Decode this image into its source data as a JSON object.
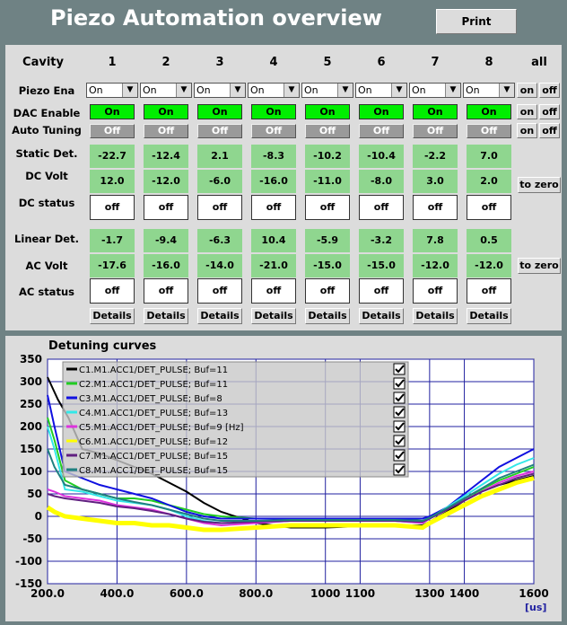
{
  "title": "Piezo Automation overview",
  "print_label": "Print",
  "cavity_header": "Cavity",
  "all_label": "all",
  "cavities": [
    "1",
    "2",
    "3",
    "4",
    "5",
    "6",
    "7",
    "8"
  ],
  "rows": {
    "piezo_ena": "Piezo Ena",
    "dac_enable": "DAC Enable",
    "auto_tuning": "Auto Tuning",
    "static_det": "Static Det.",
    "dc_volt": "DC Volt",
    "dc_status": "DC status",
    "linear_det": "Linear Det.",
    "ac_volt": "AC Volt",
    "ac_status": "AC status"
  },
  "piezo_ena": [
    "On",
    "On",
    "On",
    "On",
    "On",
    "On",
    "On",
    "On"
  ],
  "dac_enable": [
    "On",
    "On",
    "On",
    "On",
    "On",
    "On",
    "On",
    "On"
  ],
  "auto_tuning": [
    "Off",
    "Off",
    "Off",
    "Off",
    "Off",
    "Off",
    "Off",
    "Off"
  ],
  "static_det": [
    "-22.7",
    "-12.4",
    "2.1",
    "-8.3",
    "-10.2",
    "-10.4",
    "-2.2",
    "7.0"
  ],
  "dc_volt": [
    "12.0",
    "-12.0",
    "-6.0",
    "-16.0",
    "-11.0",
    "-8.0",
    "3.0",
    "2.0"
  ],
  "dc_status": [
    "off",
    "off",
    "off",
    "off",
    "off",
    "off",
    "off",
    "off"
  ],
  "linear_det": [
    "-1.7",
    "-9.4",
    "-6.3",
    "10.4",
    "-5.9",
    "-3.2",
    "7.8",
    "0.5"
  ],
  "ac_volt": [
    "-17.6",
    "-16.0",
    "-14.0",
    "-21.0",
    "-15.0",
    "-15.0",
    "-12.0",
    "-12.0"
  ],
  "ac_status": [
    "off",
    "off",
    "off",
    "off",
    "off",
    "off",
    "off",
    "off"
  ],
  "details_label": "Details",
  "on_label": "on",
  "off_label": "off",
  "to_zero_label": "to zero",
  "chart_data": {
    "type": "line",
    "title": "Detuning curves",
    "xlabel": "[us]",
    "xlim": [
      200,
      1600
    ],
    "ylim": [
      -150,
      350
    ],
    "x_ticks": [
      "200.0",
      "400.0",
      "600.0",
      "800.0",
      "1000",
      "1100",
      "1300",
      "1400",
      "1600"
    ],
    "x_tick_values": [
      200,
      400,
      600,
      800,
      1000,
      1100,
      1300,
      1400,
      1600
    ],
    "y_ticks": [
      "350",
      "300",
      "250",
      "200",
      "150",
      "100",
      "50",
      "0",
      "-50",
      "-100",
      "-150"
    ],
    "legend": [
      {
        "name": "C1.M1.ACC1/DET_PULSE; Buf=11",
        "color": "#000000"
      },
      {
        "name": "C2.M1.ACC1/DET_PULSE; Buf=11",
        "color": "#22cc22"
      },
      {
        "name": "C3.M1.ACC1/DET_PULSE; Buf=8",
        "color": "#1010e0"
      },
      {
        "name": "C4.M1.ACC1/DET_PULSE; Buf=13",
        "color": "#33e8e8"
      },
      {
        "name": "C5.M1.ACC1/DET_PULSE; Buf=9 [Hz]",
        "color": "#dd33dd"
      },
      {
        "name": "C6.M1.ACC1/DET_PULSE; Buf=12",
        "color": "#ffff00"
      },
      {
        "name": "C7.M1.ACC1/DET_PULSE; Buf=15",
        "color": "#602080"
      },
      {
        "name": "C8.M1.ACC1/DET_PULSE; Buf=15",
        "color": "#208080"
      }
    ],
    "series": [
      {
        "name": "C1.M1.ACC1/DET_PULSE; Buf=11",
        "color": "#000000",
        "x": [
          200,
          230,
          260,
          300,
          350,
          400,
          450,
          500,
          550,
          600,
          650,
          700,
          800,
          900,
          1000,
          1100,
          1200,
          1280,
          1300,
          1350,
          1400,
          1450,
          1500,
          1550,
          1600
        ],
        "y": [
          310,
          260,
          220,
          150,
          140,
          125,
          110,
          95,
          75,
          55,
          30,
          10,
          -15,
          -25,
          -25,
          -22,
          -20,
          -20,
          -12,
          10,
          35,
          55,
          70,
          80,
          90
        ]
      },
      {
        "name": "C2.M1.ACC1/DET_PULSE; Buf=11",
        "color": "#22cc22",
        "x": [
          200,
          220,
          250,
          300,
          350,
          400,
          450,
          500,
          550,
          600,
          650,
          700,
          800,
          900,
          1000,
          1100,
          1200,
          1280,
          1300,
          1350,
          1400,
          1450,
          1500,
          1550,
          1600
        ],
        "y": [
          220,
          170,
          80,
          60,
          50,
          40,
          40,
          35,
          25,
          15,
          5,
          0,
          -5,
          -5,
          -5,
          -5,
          -5,
          -10,
          -5,
          15,
          40,
          60,
          80,
          95,
          110
        ]
      },
      {
        "name": "C3.M1.ACC1/DET_PULSE; Buf=8",
        "color": "#1010e0",
        "x": [
          200,
          220,
          250,
          300,
          350,
          400,
          450,
          500,
          550,
          600,
          650,
          700,
          800,
          900,
          1000,
          1100,
          1200,
          1280,
          1300,
          1350,
          1400,
          1450,
          1500,
          1550,
          1600
        ],
        "y": [
          270,
          200,
          100,
          85,
          70,
          60,
          50,
          40,
          25,
          10,
          0,
          -5,
          -5,
          -5,
          -5,
          -5,
          -5,
          -5,
          0,
          20,
          50,
          80,
          110,
          130,
          150
        ]
      },
      {
        "name": "C4.M1.ACC1/DET_PULSE; Buf=13",
        "color": "#33e8e8",
        "x": [
          200,
          220,
          250,
          300,
          350,
          400,
          450,
          500,
          550,
          600,
          650,
          700,
          800,
          900,
          1000,
          1100,
          1200,
          1280,
          1300,
          1350,
          1400,
          1450,
          1500,
          1550,
          1600
        ],
        "y": [
          200,
          150,
          60,
          55,
          45,
          35,
          30,
          25,
          15,
          0,
          -10,
          -15,
          -15,
          -10,
          -10,
          -10,
          -10,
          -15,
          -5,
          20,
          45,
          70,
          95,
          115,
          130
        ]
      },
      {
        "name": "C5.M1.ACC1/DET_PULSE; Buf=9 [Hz]",
        "color": "#dd33dd",
        "x": [
          200,
          220,
          250,
          300,
          350,
          400,
          450,
          500,
          550,
          600,
          650,
          700,
          800,
          900,
          1000,
          1100,
          1200,
          1280,
          1300,
          1350,
          1400,
          1450,
          1500,
          1550,
          1600
        ],
        "y": [
          60,
          55,
          45,
          40,
          35,
          25,
          20,
          15,
          5,
          -5,
          -15,
          -20,
          -15,
          -10,
          -10,
          -10,
          -10,
          -15,
          -5,
          15,
          35,
          55,
          75,
          90,
          100
        ]
      },
      {
        "name": "C6.M1.ACC1/DET_PULSE; Buf=12",
        "color": "#ffff00",
        "x": [
          200,
          220,
          250,
          300,
          350,
          400,
          450,
          500,
          550,
          600,
          650,
          700,
          800,
          900,
          1000,
          1100,
          1200,
          1280,
          1300,
          1350,
          1400,
          1450,
          1500,
          1550,
          1600
        ],
        "y": [
          20,
          10,
          0,
          -5,
          -10,
          -15,
          -15,
          -20,
          -20,
          -25,
          -30,
          -30,
          -25,
          -20,
          -20,
          -20,
          -20,
          -25,
          -15,
          5,
          25,
          45,
          60,
          75,
          85
        ]
      },
      {
        "name": "C7.M1.ACC1/DET_PULSE; Buf=15",
        "color": "#602080",
        "x": [
          200,
          220,
          250,
          300,
          350,
          400,
          450,
          500,
          550,
          600,
          650,
          700,
          800,
          900,
          1000,
          1100,
          1200,
          1280,
          1300,
          1350,
          1400,
          1450,
          1500,
          1550,
          1600
        ],
        "y": [
          50,
          45,
          40,
          35,
          30,
          22,
          18,
          12,
          5,
          -5,
          -12,
          -15,
          -12,
          -10,
          -10,
          -10,
          -10,
          -12,
          -5,
          15,
          35,
          55,
          70,
          85,
          95
        ]
      },
      {
        "name": "C8.M1.ACC1/DET_PULSE; Buf=15",
        "color": "#208080",
        "x": [
          200,
          220,
          250,
          300,
          350,
          400,
          450,
          500,
          550,
          600,
          650,
          700,
          800,
          900,
          1000,
          1100,
          1200,
          1280,
          1300,
          1350,
          1400,
          1450,
          1500,
          1550,
          1600
        ],
        "y": [
          150,
          110,
          70,
          60,
          50,
          40,
          32,
          25,
          15,
          5,
          -5,
          -10,
          -10,
          -8,
          -8,
          -8,
          -8,
          -10,
          -3,
          18,
          40,
          62,
          85,
          100,
          115
        ]
      }
    ]
  }
}
